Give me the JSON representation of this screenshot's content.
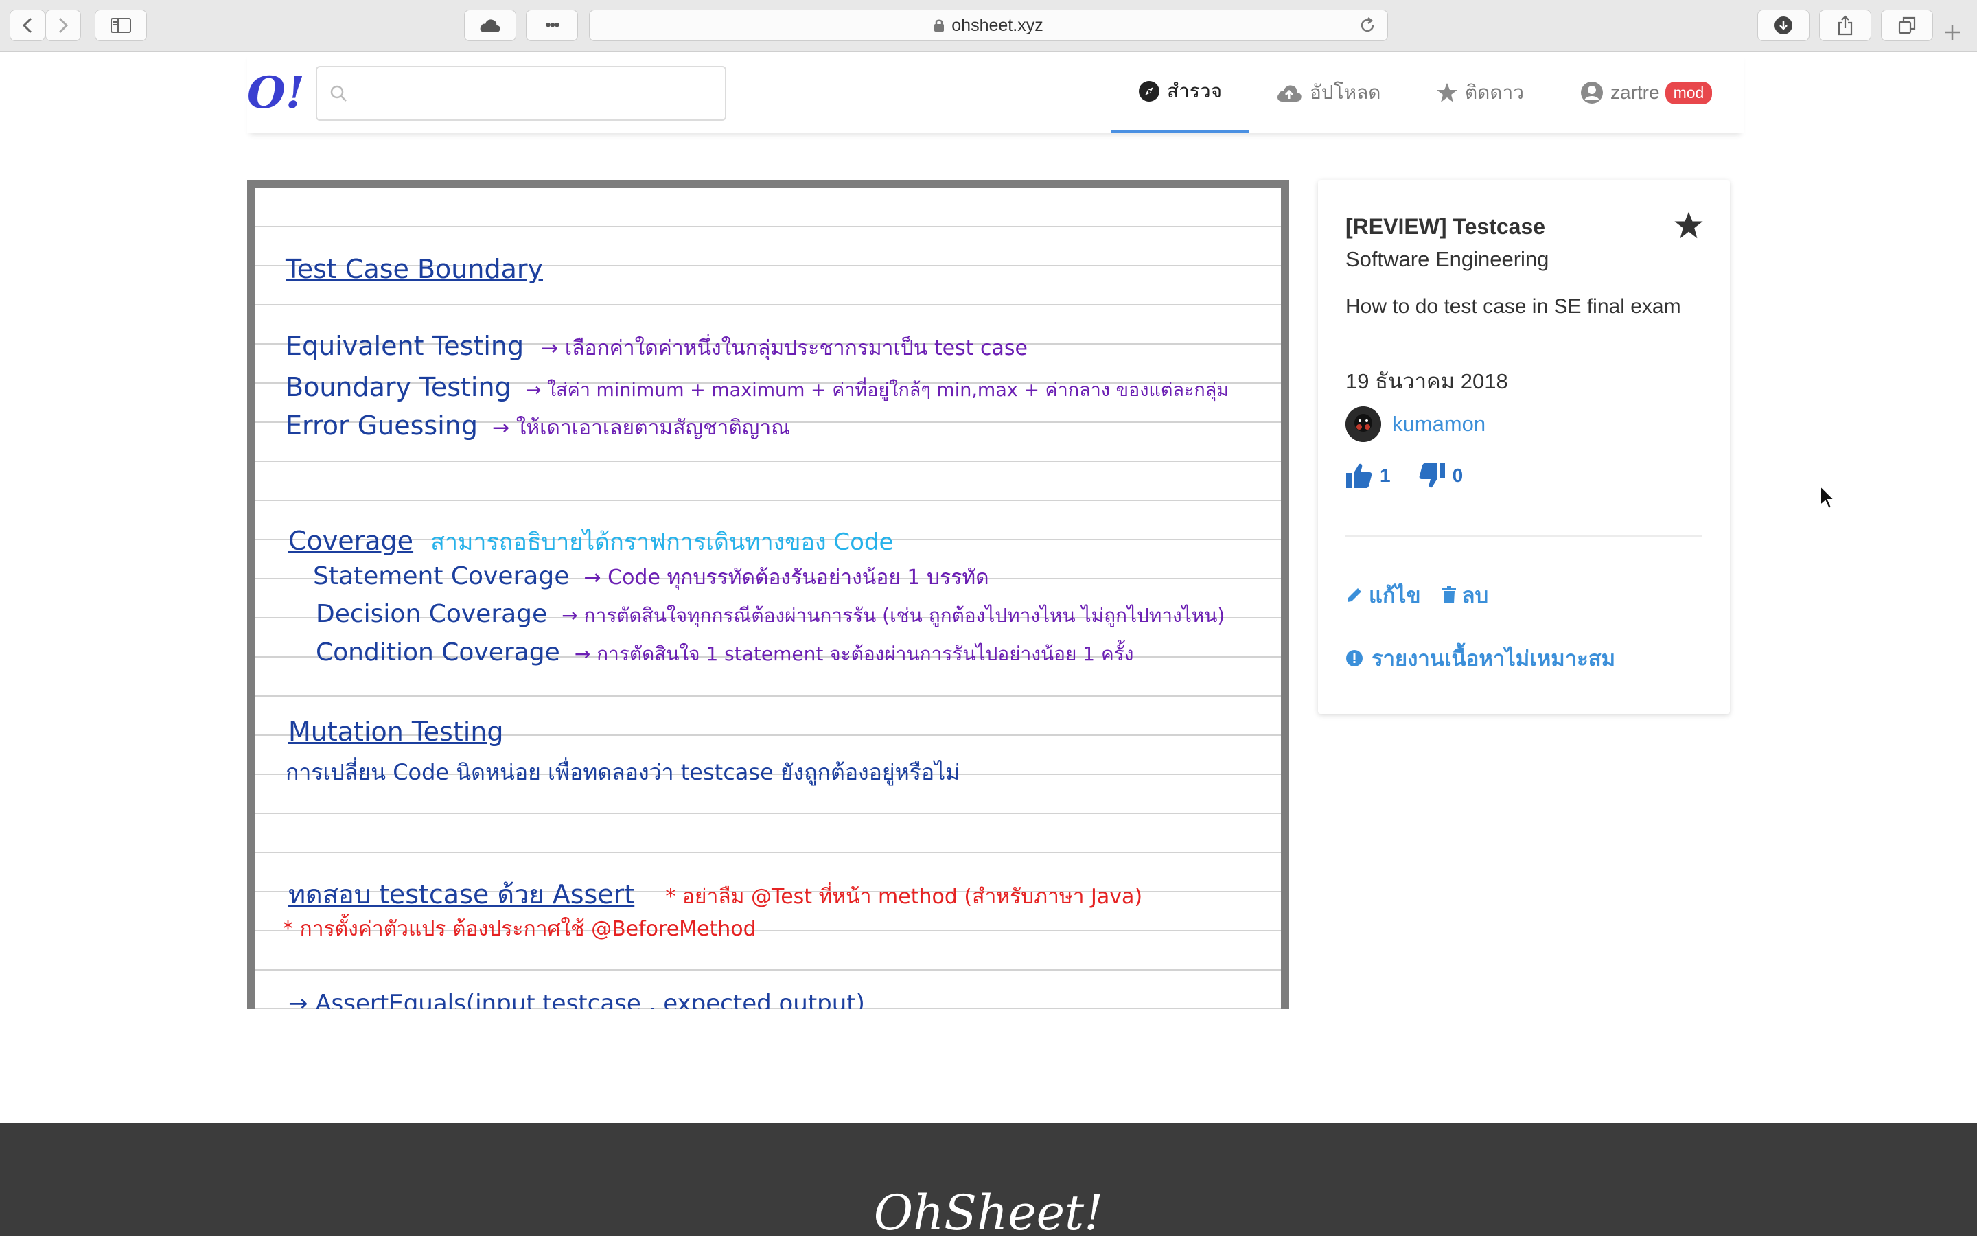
{
  "browser": {
    "url": "ohsheet.xyz",
    "dots": "•••"
  },
  "header": {
    "logo": "O!",
    "search_placeholder": "",
    "nav": [
      {
        "label": "สำรวจ",
        "icon": "compass-icon",
        "active": true
      },
      {
        "label": "อัปโหลด",
        "icon": "cloud-upload-icon",
        "active": false
      },
      {
        "label": "ติดดาว",
        "icon": "star-icon",
        "active": false
      }
    ],
    "user": {
      "name": "zartre",
      "badge": "mod"
    }
  },
  "note": {
    "lines": [
      {
        "text": "Test Case Boundary",
        "style": "blue u"
      },
      {
        "text": "Equivalent Testing → เลือกค่าใดค่าหนึ่งในกลุ่มประชากรมาเป็น test case",
        "style": "mixed"
      },
      {
        "text": "Boundary Testing → ใส่ค่า minimum + maximum + ค่าที่อยู่ใกล้ๆ min,max + ค่ากลาง ของแต่ละกลุ่ม",
        "style": "mixed"
      },
      {
        "text": "Error Guessing → ให้เดาเอาเลยตามสัญชาติญาณ",
        "style": "mixed"
      },
      {
        "text": "Coverage",
        "style": "blue u"
      },
      {
        "text": "สามารถอธิบายได้กราฟการเดินทางของ Code",
        "style": "cyan"
      },
      {
        "text": "Statement Coverage → Code ทุกบรรทัดต้องรันอย่างน้อย 1 บรรทัด",
        "style": "mixed"
      },
      {
        "text": "Decision Coverage → การตัดสินใจทุกกรณีต้องผ่านการรัน (เช่น ถูกต้องไปทางไหน ไม่ถูกไปทางไหน)",
        "style": "mixed"
      },
      {
        "text": "Condition Coverage → การตัดสินใจ 1 statement จะต้องผ่านการรันไปอย่างน้อย 1 ครั้ง",
        "style": "mixed"
      },
      {
        "text": "Mutation Testing",
        "style": "blue u"
      },
      {
        "text": "การเปลี่ยน Code นิดหน่อย เพื่อทดลองว่า testcase ยังถูกต้องอยู่หรือไม่",
        "style": "blue"
      },
      {
        "text": "ทดสอบ testcase ด้วย Assert",
        "style": "blue u"
      },
      {
        "text": "* อย่าลืม @Test ที่หน้า method (สำหรับภาษา Java)",
        "style": "red"
      },
      {
        "text": "* การตั้งค่าตัวแปร ต้องประกาศใช้ @BeforeMethod",
        "style": "red"
      },
      {
        "text": "→ AssertEquals(input testcase , expected output)",
        "style": "blue"
      }
    ],
    "parts": {
      "eq_a": "Equivalent Testing",
      "eq_b": "→ เลือกค่าใดค่าหนึ่งในกลุ่มประชากรมาเป็น test case",
      "bt_a": "Boundary Testing",
      "bt_b": "→ ใส่ค่า minimum + maximum + ค่าที่อยู่ใกล้ๆ min,max + ค่ากลาง   ของแต่ละกลุ่ม",
      "eg_a": "Error Guessing",
      "eg_b": "→ ให้เดาเอาเลยตามสัญชาติญาณ",
      "st_a": "Statement Coverage",
      "st_b": "→ Code ทุกบรรทัดต้องรันอย่างน้อย 1 บรรทัด",
      "dc_a": "Decision Coverage",
      "dc_b": "→ การตัดสินใจทุกกรณีต้องผ่านการรัน (เช่น ถูกต้องไปทางไหน ไม่ถูกไปทางไหน)",
      "cc_a": "Condition Coverage",
      "cc_b": "→ การตัดสินใจ 1 statement จะต้องผ่านการรันไปอย่างน้อย 1 ครั้ง"
    }
  },
  "card": {
    "title": "[REVIEW] Testcase",
    "subject": "Software Engineering",
    "description": "How to do test case in SE final exam",
    "date": "19 ธันวาคม 2018",
    "author": "kumamon",
    "likes": "1",
    "dislikes": "0",
    "edit_label": "แก้ไข",
    "delete_label": "ลบ",
    "report_label": "รายงานเนื้อหาไม่เหมาะสม"
  },
  "footer": {
    "logo": "OhSheet!"
  },
  "colors": {
    "accent_blue": "#3b8fd9",
    "nav_underline": "#4a90e2",
    "mod_badge": "#e8474c",
    "logo_blue": "#3a3fd0",
    "footer_bg": "#3c3c3c"
  }
}
